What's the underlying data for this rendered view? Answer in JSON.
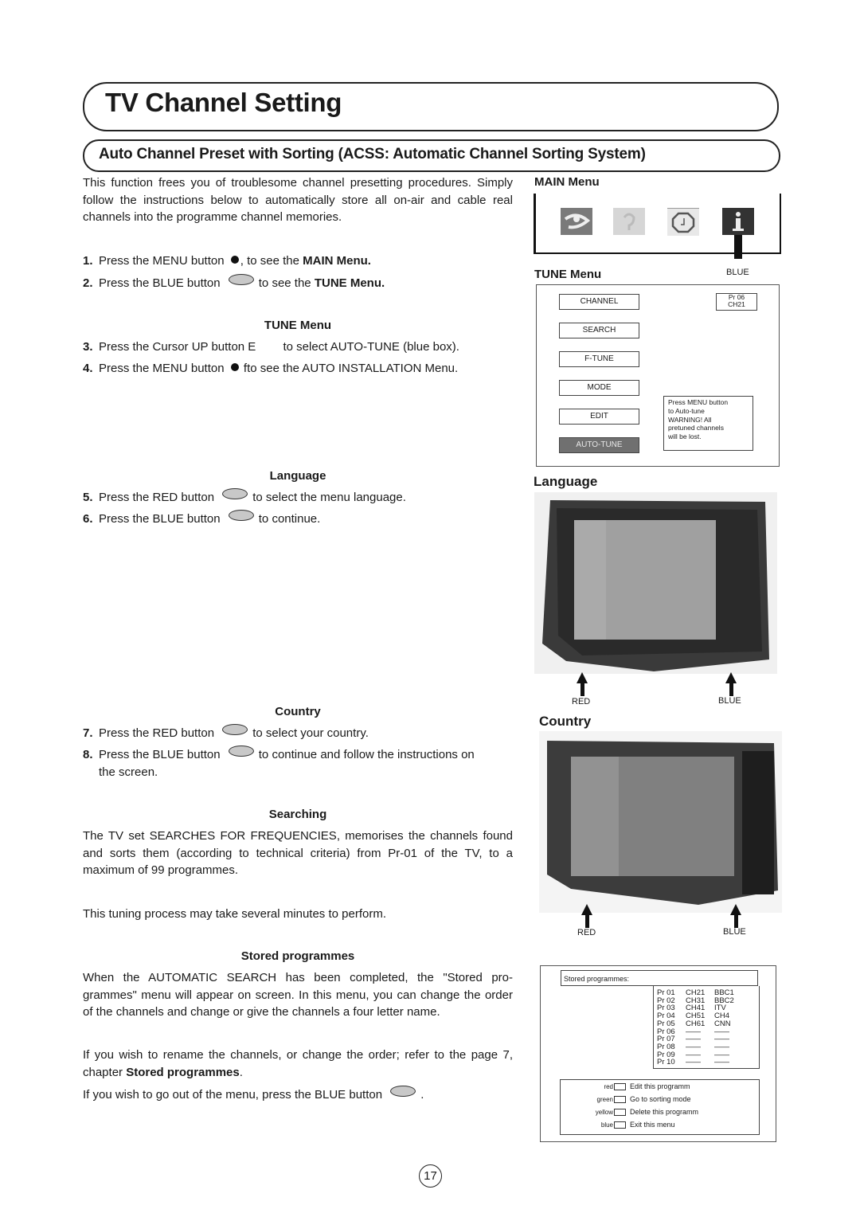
{
  "page": {
    "title": "TV Channel Setting",
    "subtitle": "Auto Channel Preset with Sorting (ACSS: Automatic Channel Sorting System)",
    "page_number": "17"
  },
  "intro": "This function frees you of troublesome channel presetting procedures. Simply follow the instructions below to automatically store all on-air and cable real channels into the programme channel memories.",
  "steps": {
    "s1": {
      "num": "1.",
      "pre": "Press the MENU button",
      "mid": ", to see the ",
      "bold": "MAIN Menu."
    },
    "s2": {
      "num": "2.",
      "pre": "Press the BLUE button",
      "mid": "to see the ",
      "bold": "TUNE Menu."
    },
    "tune_heading": "TUNE Menu",
    "s3": {
      "num": "3.",
      "pre": "Press the Cursor UP button  E",
      "post": "to select AUTO-TUNE (blue box)."
    },
    "s4": {
      "num": "4.",
      "pre": "Press the MENU button",
      "post": "fto see the AUTO INSTALLATION Menu."
    },
    "language_heading": "Language",
    "s5": {
      "num": "5.",
      "pre": "Press the RED button",
      "post": "to select the menu language."
    },
    "s6": {
      "num": "6.",
      "pre": "Press the BLUE button",
      "post": "to continue."
    },
    "country_heading": "Country",
    "s7": {
      "num": "7.",
      "pre": "Press the RED button",
      "post": "to select your country."
    },
    "s8": {
      "num": "8.",
      "pre": "Press the BLUE button",
      "post": "to continue and follow the instructions on",
      "cont": "the screen."
    },
    "searching_heading": "Searching",
    "searching_text": "The TV set SEARCHES FOR FREQUENCIES, memorises the channels found and sorts them (according to technical criteria) from Pr-01 of the TV, to a maximum of 99 programmes.",
    "tuning_note": "This tuning process may take several minutes to perform.",
    "stored_heading": "Stored programmes",
    "stored_text": "When the AUTOMATIC SEARCH has been completed, the \"Stored pro-grammes\" menu will appear on screen. In this menu, you can change the order of the channels and change or give the channels a four letter name.",
    "rename_pre": "If you wish to rename the channels, or change the order; refer to the page 7, chapter ",
    "rename_bold": "Stored programmes",
    "rename_post": ".",
    "exit_pre": "If you wish to go out of the menu, press the BLUE button",
    "exit_post": "."
  },
  "main_menu": {
    "heading": "MAIN Menu",
    "icons": [
      "picture-icon",
      "sound-icon",
      "timer-icon",
      "info-icon"
    ],
    "pointer_label": "BLUE"
  },
  "tune_menu": {
    "heading": "TUNE Menu",
    "buttons": [
      "CHANNEL",
      "SEARCH",
      "F-TUNE",
      "MODE",
      "EDIT",
      "AUTO-TUNE"
    ],
    "selected": "AUTO-TUNE",
    "status_pr": "Pr 06",
    "status_ch": "CH21",
    "message": [
      "Press MENU button",
      "to Auto-tune",
      "WARNING! All",
      "pretuned channels",
      "will be lost."
    ]
  },
  "language_panel": {
    "heading": "Language",
    "left_label": "RED",
    "right_label": "BLUE"
  },
  "country_panel": {
    "heading": "Country",
    "left_label": "RED",
    "right_label": "BLUE"
  },
  "stored_panel": {
    "title": "Stored programmes:",
    "rows": [
      {
        "pr": "Pr 01",
        "ch": "CH21",
        "name": "BBC1"
      },
      {
        "pr": "Pr 02",
        "ch": "CH31",
        "name": "BBC2"
      },
      {
        "pr": "Pr 03",
        "ch": "CH41",
        "name": "ITV"
      },
      {
        "pr": "Pr 04",
        "ch": "CH51",
        "name": "CH4"
      },
      {
        "pr": "Pr 05",
        "ch": "CH61",
        "name": "CNN"
      },
      {
        "pr": "Pr 06",
        "ch": "——",
        "name": "——"
      },
      {
        "pr": "Pr 07",
        "ch": "——",
        "name": "——"
      },
      {
        "pr": "Pr 08",
        "ch": "——",
        "name": "——"
      },
      {
        "pr": "Pr 09",
        "ch": "——",
        "name": "——"
      },
      {
        "pr": "Pr 10",
        "ch": "——",
        "name": "——"
      }
    ],
    "legend": [
      {
        "color": "red",
        "action": "Edit this programm"
      },
      {
        "color": "green",
        "action": "Go to sorting mode"
      },
      {
        "color": "yellow",
        "action": "Delete this programm"
      },
      {
        "color": "blue",
        "action": "Exit this menu"
      }
    ]
  }
}
